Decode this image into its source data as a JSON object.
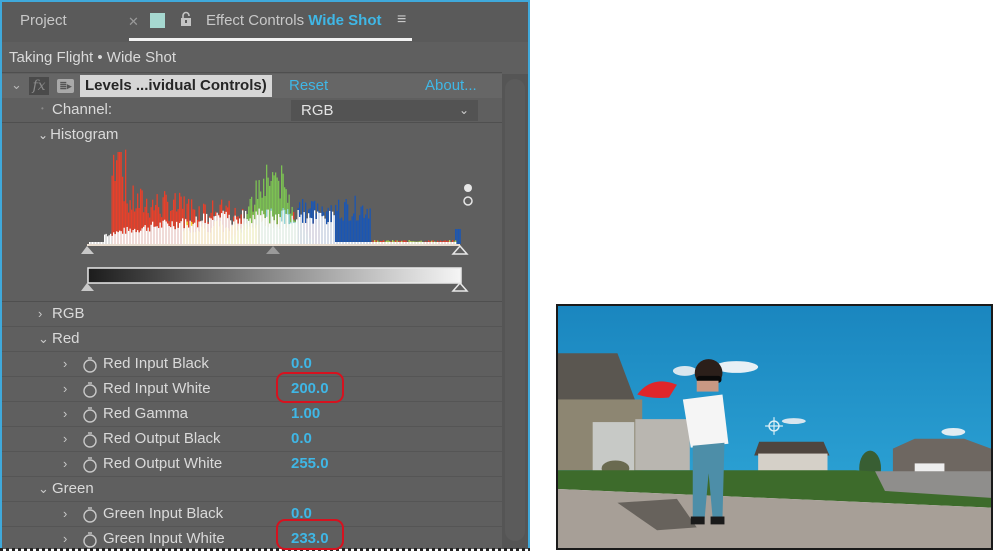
{
  "panel": {
    "tabs": [
      {
        "label": "Project"
      },
      {
        "label": "Effect Controls",
        "clip_name": "Wide Shot",
        "active": true
      }
    ],
    "icons": {
      "close": "close-icon",
      "swatch": "label-color-swatch",
      "lock": "lock-icon",
      "menu": "panel-menu-icon"
    },
    "colors": {
      "accent": "#3fb7e6",
      "panel_bg": "#5f5f5f",
      "highlight_ring": "#d6121f",
      "swatch": "#a6d8d0"
    },
    "breadcrumb": "Taking Flight • Wide Shot",
    "effect": {
      "name": "Levels ...ividual Controls)",
      "reset_label": "Reset",
      "about_label": "About...",
      "fx_icon": "fx",
      "preset_icon": "≣▸"
    },
    "channel": {
      "label": "Channel:",
      "value": "RGB"
    },
    "histogram": {
      "label": "Histogram",
      "input_black_slider": 0,
      "input_gamma_slider": 0.5,
      "input_white_slider": 1.0,
      "output_black_slider": 0,
      "output_white_slider": 1.0
    },
    "groups": [
      {
        "label": "RGB",
        "expanded": false
      },
      {
        "label": "Red",
        "expanded": true,
        "properties": [
          {
            "label": "Red Input Black",
            "value": "0.0"
          },
          {
            "label": "Red Input White",
            "value": "200.0",
            "highlighted": true
          },
          {
            "label": "Red Gamma",
            "value": "1.00"
          },
          {
            "label": "Red Output Black",
            "value": "0.0"
          },
          {
            "label": "Red Output White",
            "value": "255.0"
          }
        ]
      },
      {
        "label": "Green",
        "expanded": true,
        "properties": [
          {
            "label": "Green Input Black",
            "value": "0.0"
          },
          {
            "label": "Green Input White",
            "value": "233.0",
            "highlighted": true
          }
        ]
      }
    ]
  },
  "preview": {
    "description": "Boy in sunglasses and red cape standing on a driveway under a blue sky",
    "colors": {
      "sky": "#1e8ec4",
      "grass": "#3d6b2b",
      "pavement": "#a79f97",
      "cape": "#e0262a"
    }
  }
}
